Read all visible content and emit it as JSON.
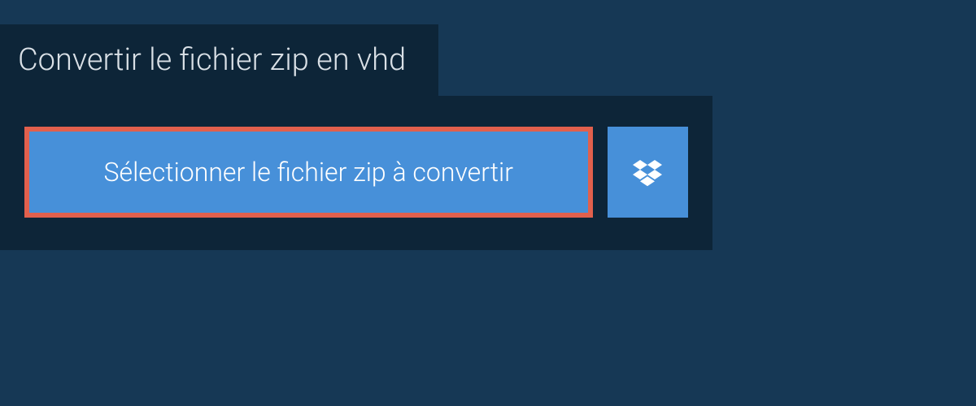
{
  "tab": {
    "title": "Convertir le fichier zip en vhd"
  },
  "buttons": {
    "select_file_label": "Sélectionner le fichier zip à convertir"
  },
  "icons": {
    "dropbox": "dropbox-icon"
  },
  "colors": {
    "background": "#163855",
    "panel": "#0d2538",
    "primary_button": "#4790d9",
    "highlight_border": "#e1604d",
    "text_light": "#d9e0e6"
  }
}
